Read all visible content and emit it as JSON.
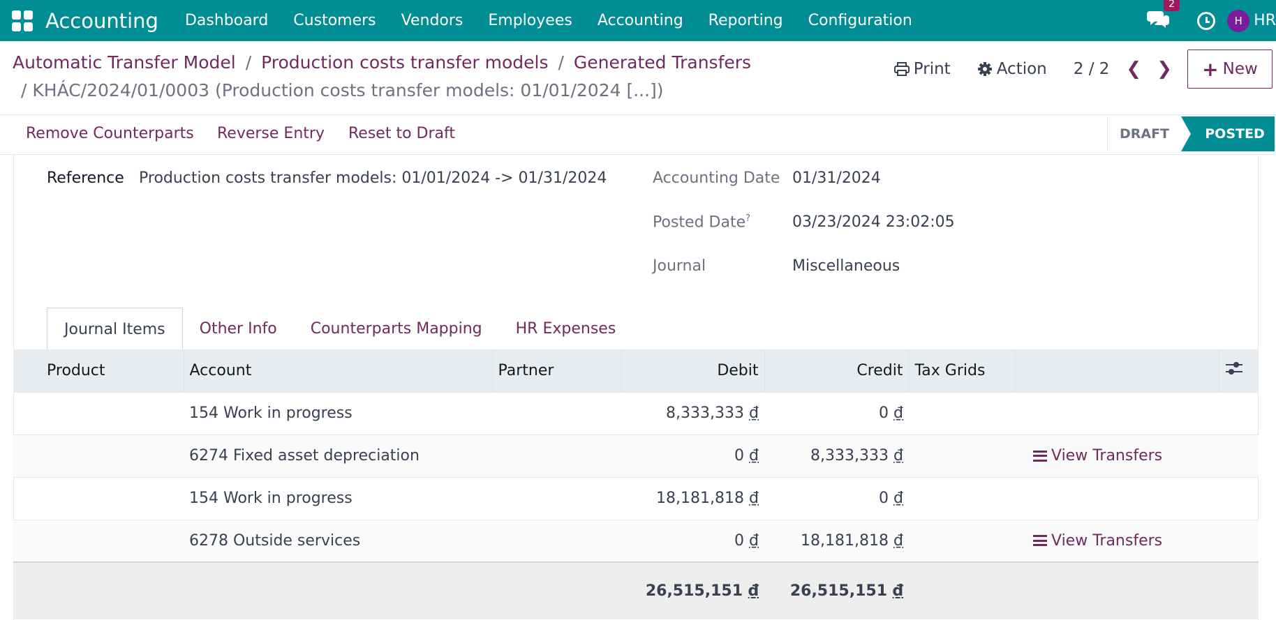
{
  "topbar": {
    "app_name": "Accounting",
    "nav": [
      "Dashboard",
      "Customers",
      "Vendors",
      "Employees",
      "Accounting",
      "Reporting",
      "Configuration"
    ],
    "chat_badge": "2",
    "avatar_initial": "H",
    "user": "HR"
  },
  "breadcrumb": {
    "items": [
      "Automatic Transfer Model",
      "Production costs transfer models",
      "Generated Transfers"
    ],
    "current": "KHÁC/2024/01/0003 (Production costs transfer models: 01/01/2024 [...])"
  },
  "controls": {
    "print": "Print",
    "action": "Action",
    "pager": "2 / 2",
    "new": "New"
  },
  "actions": [
    "Remove Counterparts",
    "Reverse Entry",
    "Reset to Draft"
  ],
  "status": {
    "draft": "DRAFT",
    "posted": "POSTED"
  },
  "form": {
    "reference_label": "Reference",
    "reference": "Production costs transfer models: 01/01/2024 -> 01/31/2024",
    "accounting_date_label": "Accounting Date",
    "accounting_date": "01/31/2024",
    "posted_date_label": "Posted Date",
    "posted_date_help": "?",
    "posted_date": "03/23/2024 23:02:05",
    "journal_label": "Journal",
    "journal": "Miscellaneous"
  },
  "tabs": [
    "Journal Items",
    "Other Info",
    "Counterparts Mapping",
    "HR Expenses"
  ],
  "table": {
    "headers": [
      "Product",
      "Account",
      "Partner",
      "Debit",
      "Credit",
      "Tax Grids"
    ],
    "currency": "₫",
    "rows": [
      {
        "product": "",
        "account": "154 Work in progress",
        "partner": "",
        "debit": "8,333,333",
        "credit": "0",
        "link": ""
      },
      {
        "product": "",
        "account": "6274 Fixed asset depreciation",
        "partner": "",
        "debit": "0",
        "credit": "8,333,333",
        "link": "View Transfers"
      },
      {
        "product": "",
        "account": "154 Work in progress",
        "partner": "",
        "debit": "18,181,818",
        "credit": "0",
        "link": ""
      },
      {
        "product": "",
        "account": "6278 Outside services",
        "partner": "",
        "debit": "0",
        "credit": "18,181,818",
        "link": "View Transfers"
      }
    ],
    "total_debit": "26,515,151",
    "total_credit": "26,515,151"
  },
  "colors": {
    "brand": "#018d94",
    "link": "#71295f",
    "badge": "#a0195f",
    "avatar": "#7a1b9b"
  }
}
